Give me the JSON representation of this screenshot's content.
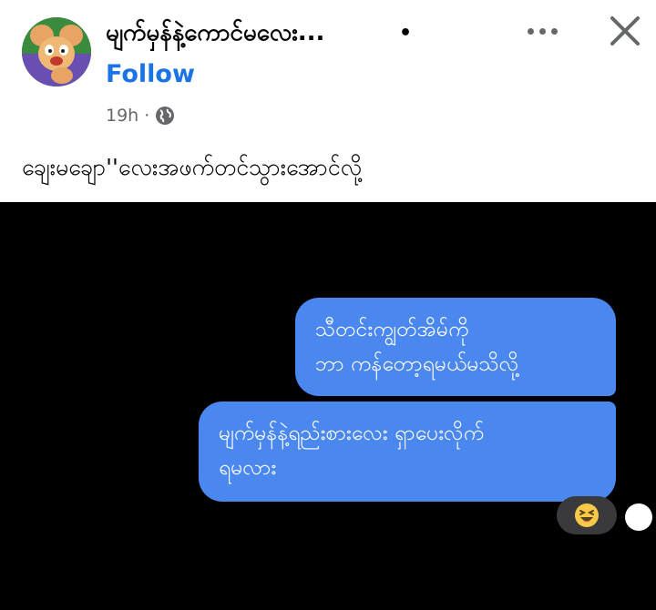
{
  "post": {
    "page_name": "မျက်မှန်နဲ့ကောင်မလေး...",
    "separator": "•",
    "follow_label": "Follow",
    "time": "19h",
    "meta_sep": "·",
    "caption": "ချေးမချော''လေးအဖက်တင်သွားအောင်လို့"
  },
  "chat": {
    "messages": [
      {
        "lines": [
          "သီတင်းကျွတ်အိမ်ကို",
          "ဘာ ကန်တော့ရမယ်မသိလို့"
        ]
      },
      {
        "lines": [
          "မျက်မှန်နဲ့ရည်းစားလေး ရှာပေးလိုက်",
          "ရမလား"
        ]
      }
    ],
    "reaction": "laughing-emoji"
  },
  "colors": {
    "accent": "#1b74e4",
    "bubble": "#4a87ee",
    "chat_background": "#000000",
    "meta_text": "#65676b"
  },
  "icons": [
    "globe-icon",
    "more-icon",
    "close-icon",
    "laughing-emoji-icon"
  ]
}
